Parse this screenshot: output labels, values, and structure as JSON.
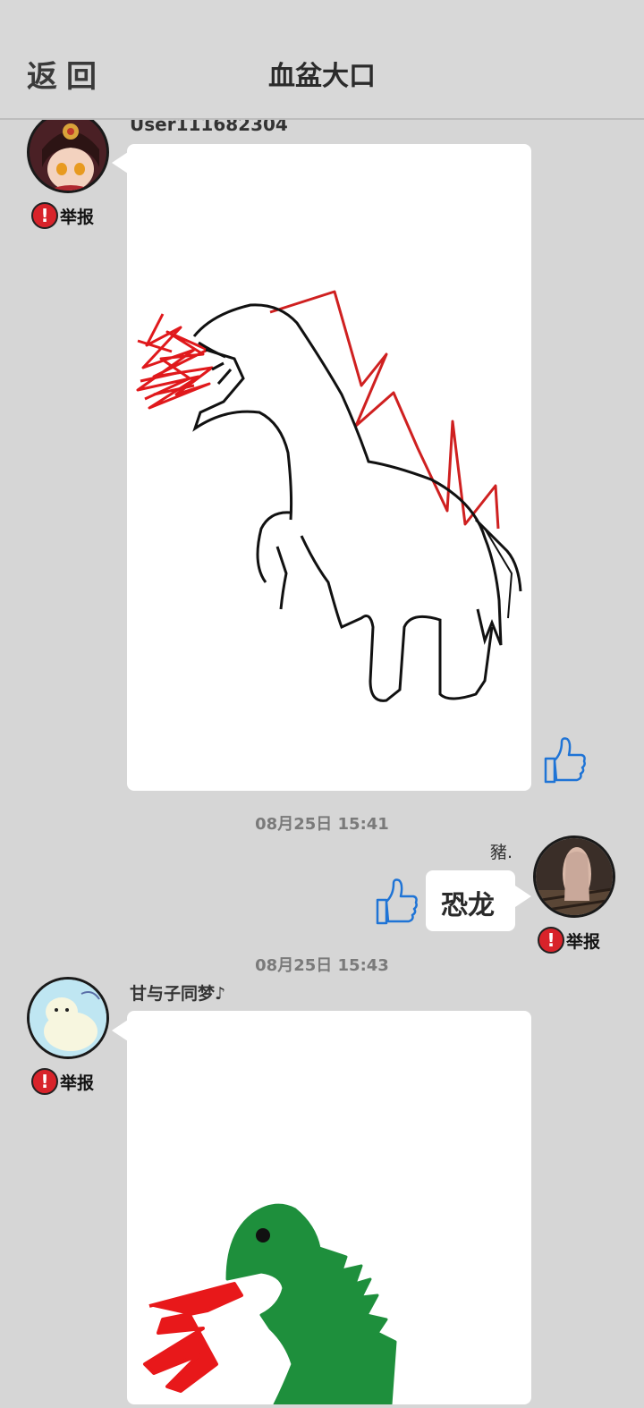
{
  "header": {
    "back_label": "返回",
    "title": "血盆大口"
  },
  "messages": [
    {
      "username": "User111682304",
      "report_label": "举报"
    },
    {
      "timestamp": "08月25日  15:41",
      "username": "豬.",
      "text": "恐龙",
      "report_label": "举报"
    },
    {
      "timestamp": "08月25日  15:43",
      "username": "甘与子同梦♪",
      "report_label": "举报"
    }
  ],
  "colors": {
    "background": "#d6d6d6",
    "bubble": "#ffffff",
    "like_icon": "#1f74d6",
    "report_icon": "#d8232a"
  }
}
